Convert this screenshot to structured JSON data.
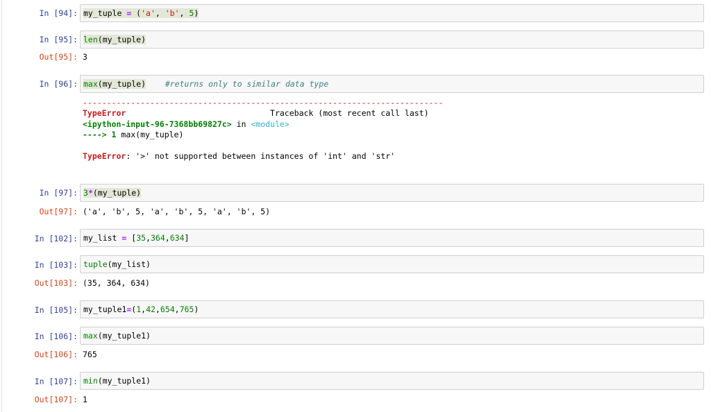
{
  "cells": [
    {
      "in_prompt": "In [94]:",
      "code": [
        "my_tuple ",
        "=",
        " (",
        "'a'",
        ", ",
        "'b'",
        ", ",
        "5",
        ")"
      ]
    },
    {
      "in_prompt": "In [95]:",
      "code": [
        "len",
        "(my_tuple)"
      ],
      "out_prompt": "Out[95]:",
      "output": "3"
    },
    {
      "in_prompt": "In [96]:",
      "code": [
        "max",
        "(my_tuple)",
        "#returns only to similar data type"
      ],
      "traceback": {
        "dashes": "---------------------------------------------------------------------------",
        "error_name": "TypeError",
        "traceback_header": "Traceback (most recent call last)",
        "location": "<ipython-input-96-7368bb69827c>",
        "location_in": " in ",
        "module": "<module>",
        "arrow": "----> 1",
        "arrow_code": " max(my_tuple)",
        "final_error_name": "TypeError",
        "final_message": ": '>' not supported between instances of 'int' and 'str'"
      }
    },
    {
      "in_prompt": "In [97]:",
      "code": [
        "3",
        "*",
        "(my_tuple)"
      ],
      "out_prompt": "Out[97]:",
      "output": "('a', 'b', 5, 'a', 'b', 5, 'a', 'b', 5)"
    },
    {
      "in_prompt": "In [102]:",
      "code": [
        "my_list ",
        "=",
        " [",
        "35",
        ",",
        "364",
        ",",
        "634",
        "]"
      ]
    },
    {
      "in_prompt": "In [103]:",
      "code": [
        "tuple",
        "(my_list)"
      ],
      "out_prompt": "Out[103]:",
      "output": "(35, 364, 634)"
    },
    {
      "in_prompt": "In [105]:",
      "code": [
        "my_tuple1",
        "=",
        "(",
        "1",
        ",",
        "42",
        ",",
        "654",
        ",",
        "765",
        ")"
      ]
    },
    {
      "in_prompt": "In [106]:",
      "code": [
        "max",
        "(my_tuple1)"
      ],
      "out_prompt": "Out[106]:",
      "output": "765"
    },
    {
      "in_prompt": "In [107]:",
      "code": [
        "min",
        "(my_tuple1)"
      ],
      "out_prompt": "Out[107]:",
      "output": "1"
    }
  ]
}
